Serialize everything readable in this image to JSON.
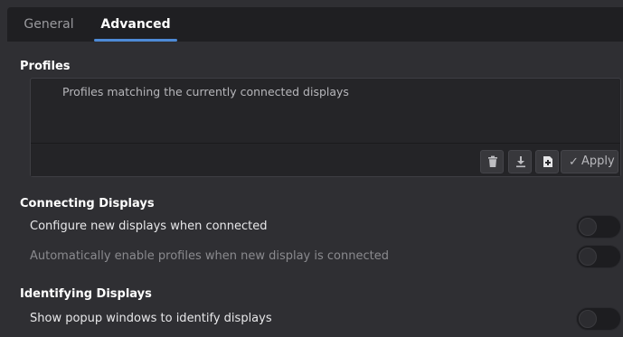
{
  "tabs": [
    {
      "label": "General",
      "active": false
    },
    {
      "label": "Advanced",
      "active": true
    }
  ],
  "profiles": {
    "title": "Profiles",
    "list_text": "Profiles matching the currently connected displays",
    "toolbar": {
      "delete_icon": "trash-icon",
      "download_icon": "download-icon",
      "new_icon": "new-document-icon",
      "apply_check": "✓",
      "apply_label": "Apply"
    }
  },
  "connecting": {
    "title": "Connecting Displays",
    "configure_label": "Configure new displays when connected",
    "configure_enabled": false,
    "auto_enable_label": "Automatically enable profiles when new display is connected",
    "auto_enable_enabled": false
  },
  "identifying": {
    "title": "Identifying Displays",
    "popup_label": "Show popup windows to identify displays",
    "popup_enabled": false
  },
  "colors": {
    "accent": "#4d8ad6",
    "background": "#2f2f33",
    "tabbar": "#1f1f22"
  }
}
